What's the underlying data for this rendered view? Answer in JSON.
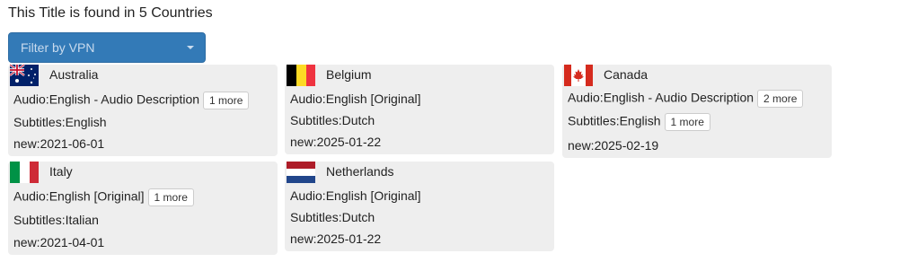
{
  "header": {
    "title": "This Title is found in 5 Countries",
    "filter_button": "Filter by VPN"
  },
  "labels": {
    "audio": "Audio:",
    "subtitles": "Subtitles:",
    "new": "new:"
  },
  "countries": [
    {
      "name": "Australia",
      "flag": "australia-flag",
      "audio": "English - Audio Description",
      "audio_more": "1 more",
      "subtitles": "English",
      "new": "2021-06-01"
    },
    {
      "name": "Belgium",
      "flag": "belgium-flag",
      "audio": "English [Original]",
      "subtitles": "Dutch",
      "new": "2025-01-22"
    },
    {
      "name": "Canada",
      "flag": "canada-flag",
      "audio": "English - Audio Description",
      "audio_more": "2 more",
      "subtitles": "English",
      "subtitles_more": "1 more",
      "new": "2025-02-19"
    },
    {
      "name": "Italy",
      "flag": "italy-flag",
      "audio": "English [Original]",
      "audio_more": "1 more",
      "subtitles": "Italian",
      "new": "2021-04-01"
    },
    {
      "name": "Netherlands",
      "flag": "netherlands-flag",
      "audio": "English [Original]",
      "subtitles": "Dutch",
      "new": "2025-01-22"
    }
  ]
}
